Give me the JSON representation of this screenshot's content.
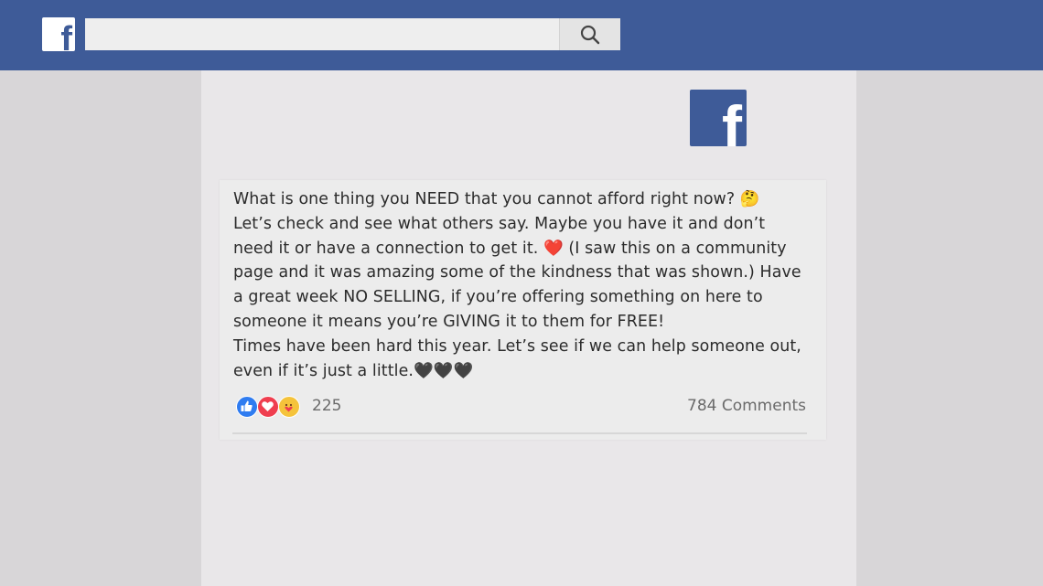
{
  "header": {
    "logo_icon": "facebook-f-icon",
    "search": {
      "placeholder": "",
      "value": ""
    },
    "search_icon": "search-icon",
    "colors": {
      "bar": "#3e5b98",
      "logo_bg": "#ffffff"
    }
  },
  "brand_logo": {
    "icon": "facebook-f-icon",
    "color": "#3e5b98"
  },
  "post": {
    "lines": [
      "What is one thing you NEED that you cannot afford right now? 🤔",
      "Let’s check and see what others say. Maybe you have it and don’t",
      "need it or have a connection to get it. ❤️ (I saw this on a community",
      "page and it was amazing some of the kindness that was shown.) Have",
      "a great week NO SELLING, if you’re offering something on here to",
      "someone it means you’re GIVING it to them for FREE!",
      "Times have been hard this year. Let’s see if we can help someone out,",
      "even if it’s just a little.🖤🖤🖤"
    ],
    "reactions": {
      "icons": [
        "like-icon",
        "love-icon",
        "care-icon"
      ],
      "count": "225"
    },
    "comments_label": "784 Comments"
  }
}
